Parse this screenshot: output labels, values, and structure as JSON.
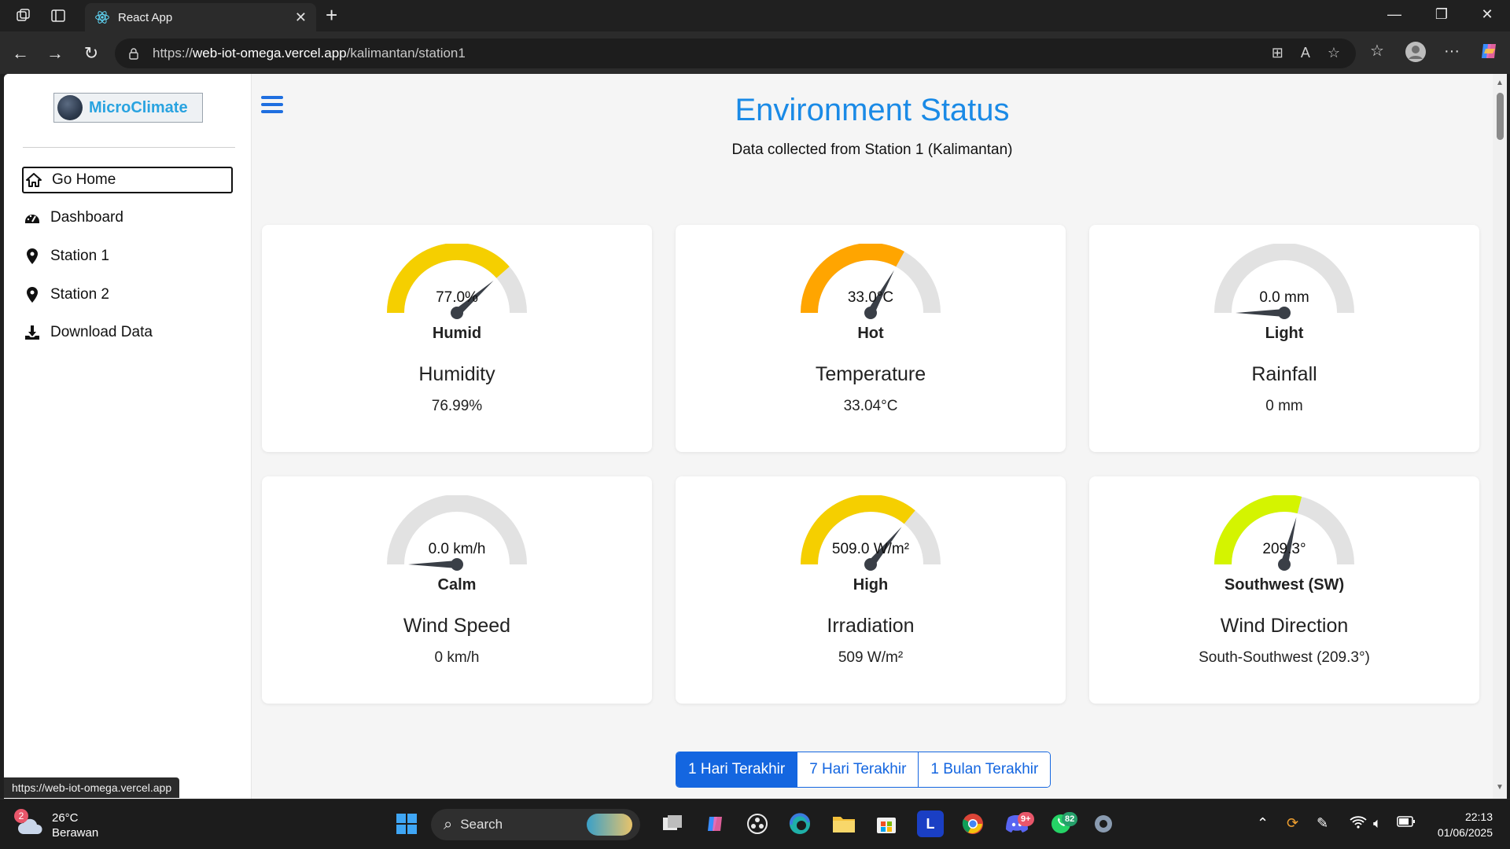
{
  "browser": {
    "tab_title": "React App",
    "url_scheme": "https://",
    "url_host": "web-iot-omega.vercel.app",
    "url_path": "/kalimantan/station1",
    "status_url": "https://web-iot-omega.vercel.app"
  },
  "sidebar": {
    "logo_text": "MicroClimate",
    "items": [
      {
        "label": "Go Home",
        "icon": "home-icon",
        "active": true
      },
      {
        "label": "Dashboard",
        "icon": "dashboard-icon",
        "active": false
      },
      {
        "label": "Station 1",
        "icon": "location-pin-icon",
        "active": false
      },
      {
        "label": "Station 2",
        "icon": "location-pin-icon",
        "active": false
      },
      {
        "label": "Download Data",
        "icon": "download-icon",
        "active": false
      }
    ]
  },
  "header": {
    "title": "Environment Status",
    "subtitle": "Data collected from Station 1 (Kalimantan)"
  },
  "cards": [
    {
      "gauge_text": "77.0%",
      "status": "Humid",
      "title": "Humidity",
      "value": "76.99%",
      "fraction": 0.77,
      "color": "#f5cf00"
    },
    {
      "gauge_text": "33.0°C",
      "status": "Hot",
      "title": "Temperature",
      "value": "33.04°C",
      "fraction": 0.66,
      "color": "#ffa500"
    },
    {
      "gauge_text": "0.0 mm",
      "status": "Light",
      "title": "Rainfall",
      "value": "0 mm",
      "fraction": 0.0,
      "color": "#e0e0e0"
    },
    {
      "gauge_text": "0.0 km/h",
      "status": "Calm",
      "title": "Wind Speed",
      "value": "0 km/h",
      "fraction": 0.0,
      "color": "#e0e0e0"
    },
    {
      "gauge_text": "509.0 W/m²",
      "status": "High",
      "title": "Irradiation",
      "value": "509 W/m²",
      "fraction": 0.72,
      "color": "#f5cf00"
    },
    {
      "gauge_text": "209.3°",
      "status": "Southwest (SW)",
      "title": "Wind Direction",
      "value": "South-Southwest (209.3°)",
      "fraction": 0.58,
      "color": "#d4f400"
    }
  ],
  "range_buttons": [
    {
      "label": "1 Hari Terakhir",
      "active": true
    },
    {
      "label": "7 Hari Terakhir",
      "active": false
    },
    {
      "label": "1 Bulan Terakhir",
      "active": false
    }
  ],
  "taskbar": {
    "weather_temp": "26°C",
    "weather_desc": "Berawan",
    "weather_badge": "2",
    "search_label": "Search",
    "discord_badge": "9+",
    "whatsapp_badge": "82",
    "time": "22:13",
    "date": "01/06/2025"
  }
}
